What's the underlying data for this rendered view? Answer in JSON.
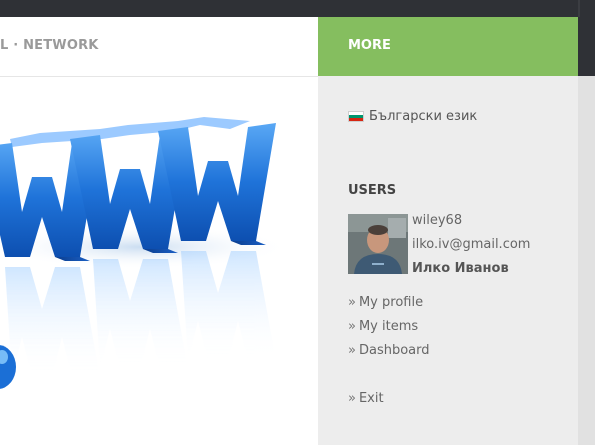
{
  "breadcrumb": "L · NETWORK",
  "sidebar": {
    "title": "MORE",
    "language": "Български език",
    "users_title": "USERS",
    "user": {
      "username": "wiley68",
      "email": "ilko.iv@gmail.com",
      "full_name": "Илко Иванов"
    },
    "links": [
      "My profile",
      "My items",
      "Dashboard"
    ],
    "exit": "Exit",
    "bullet": "»"
  },
  "colors": {
    "accent": "#85be5f",
    "sidebar_bg": "#ededed",
    "topbar": "#2f3136"
  }
}
